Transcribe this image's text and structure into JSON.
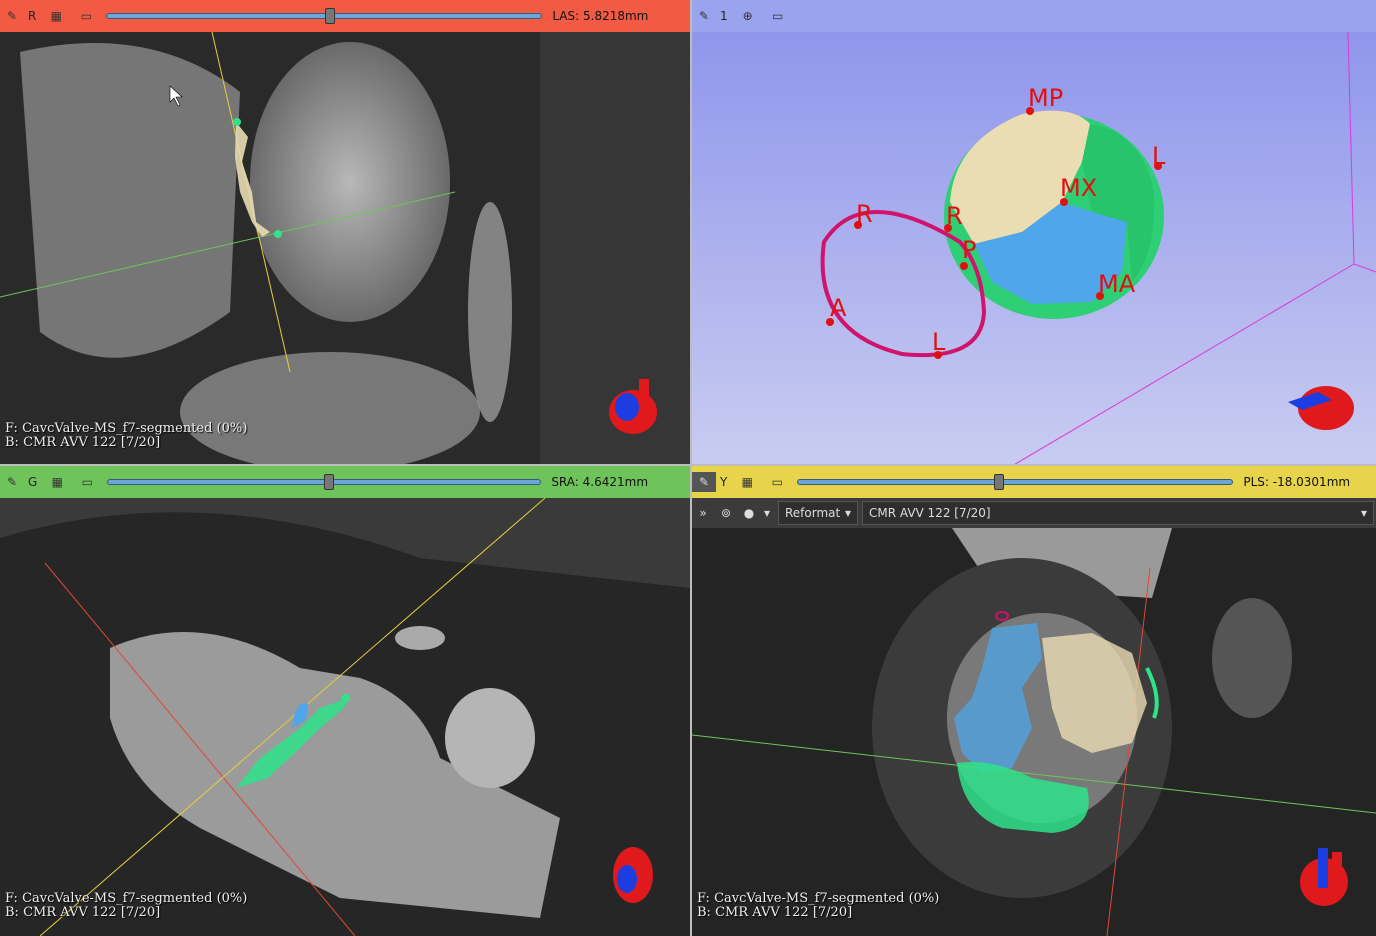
{
  "views": {
    "red": {
      "color": "#f25a43",
      "label": "R",
      "slider_fraction": 0.52,
      "readout": "LAS: 5.8218mm",
      "info_foreground": "F: CavcValve-MS_f7-segmented (0%)",
      "info_background": "B: CMR AVV 122 [7/20]"
    },
    "threed": {
      "color": "#9aa4ee",
      "label": "1",
      "landmarks": [
        "MP",
        "L",
        "MX",
        "R",
        "P",
        "MA",
        "R",
        "A",
        "L"
      ]
    },
    "green": {
      "color": "#6ec45b",
      "label": "G",
      "slider_fraction": 0.51,
      "readout": "SRA: 4.6421mm",
      "info_foreground": "F: CavcValve-MS_f7-segmented (0%)",
      "info_background": "B: CMR AVV 122 [7/20]"
    },
    "yellow": {
      "color": "#e8d44a",
      "label": "Y",
      "slider_fraction": 0.46,
      "readout": "PLS: -18.0301mm",
      "reformat_label": "Reformat",
      "volume_selector": "CMR AVV 122 [7/20]",
      "info_foreground": "F: CavcValve-MS_f7-segmented (0%)",
      "info_background": "B: CMR AVV 122 [7/20]"
    }
  },
  "icons": [
    "pin-icon",
    "link-icon",
    "maximize-icon",
    "eye-icon",
    "chevron-down-icon",
    "heart-orientation-icon",
    "expand-icon"
  ]
}
